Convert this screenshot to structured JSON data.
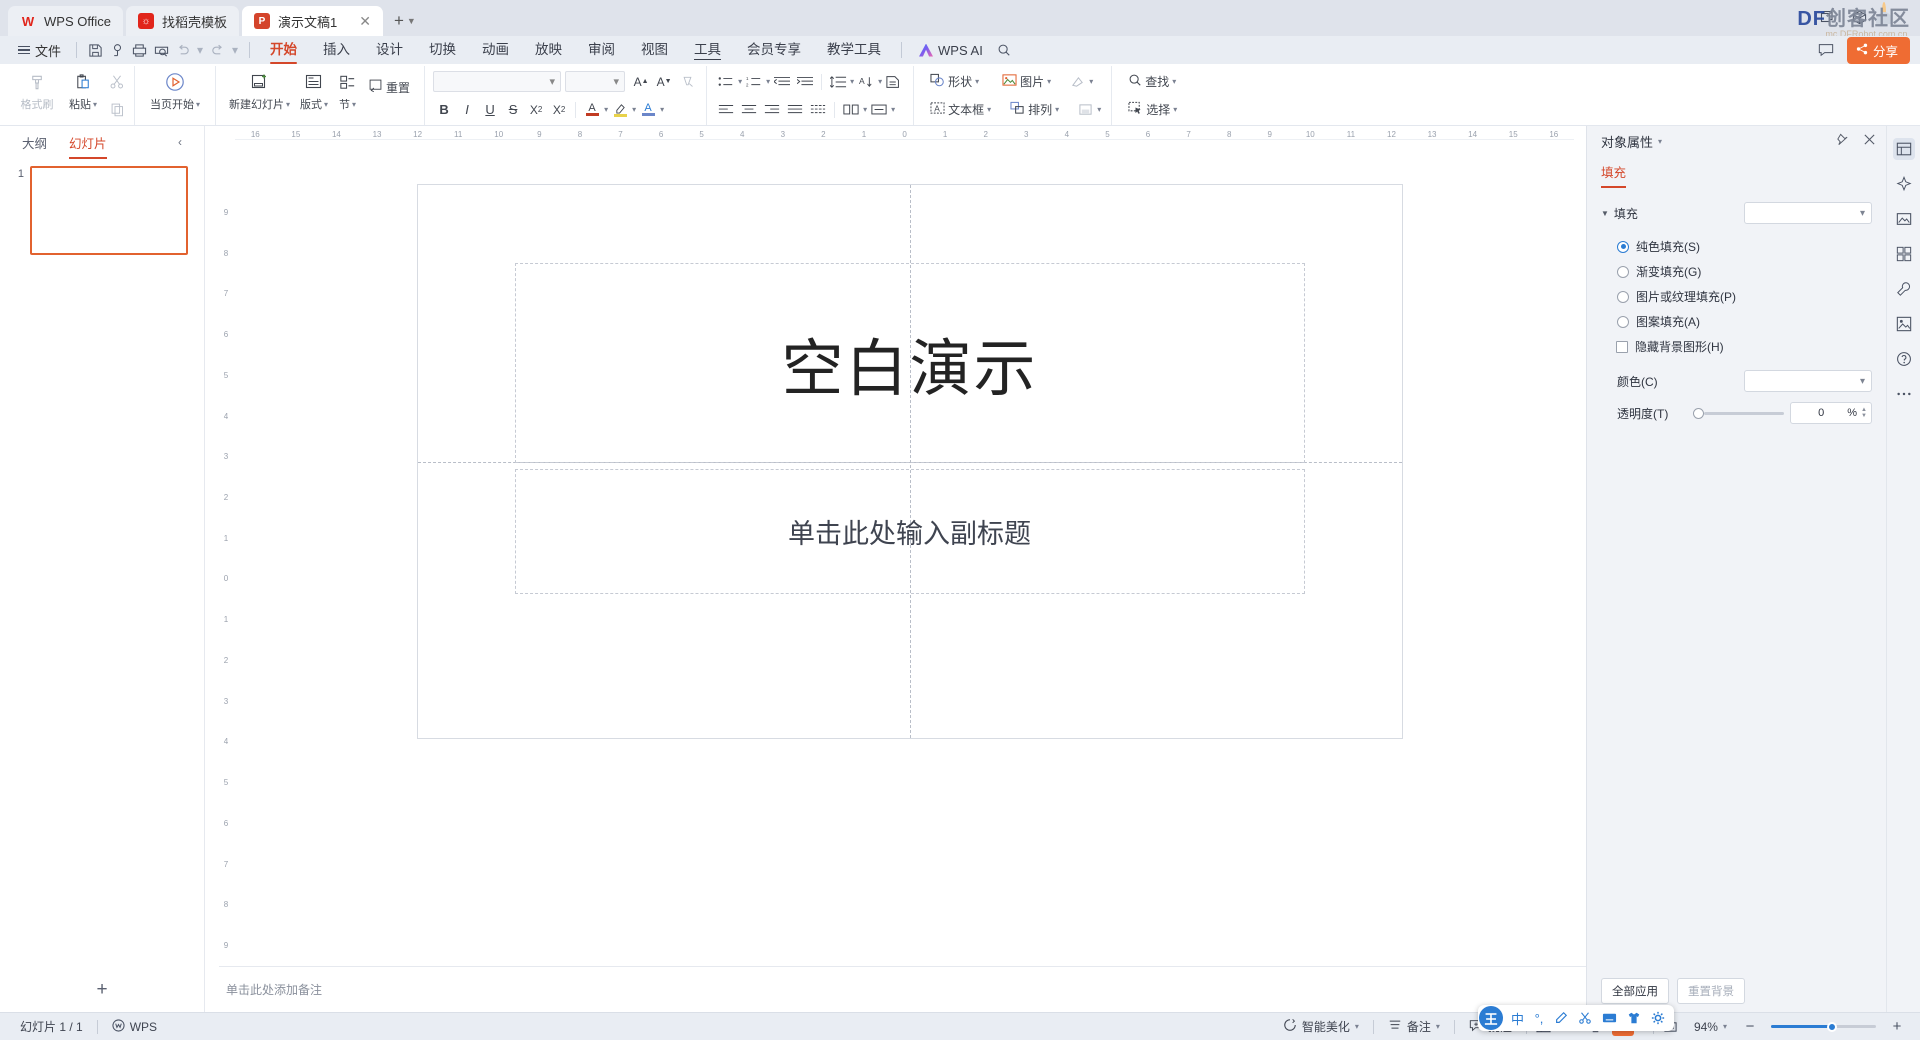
{
  "titlebar": {
    "tabs": [
      {
        "label": "WPS Office",
        "icon": "wps-logo-icon",
        "active": false,
        "closable": false
      },
      {
        "label": "找稻壳模板",
        "icon": "docer-icon",
        "active": false,
        "closable": false
      },
      {
        "label": "演示文稿1",
        "icon": "ppt-file-icon",
        "active": true,
        "closable": true
      }
    ],
    "new_tab_label": "+",
    "right_icons": [
      "window-restore-icon",
      "cube-3d-icon"
    ],
    "watermark_main": "DF",
    "watermark_cn": "创客社区",
    "watermark_sub": "mc.DFRobot.com.cn"
  },
  "menubar": {
    "file_label": "文件",
    "quick_icons": [
      "save-icon",
      "search-template-icon",
      "print-icon",
      "print-preview-icon",
      "undo-icon",
      "undo-dropdown-icon",
      "redo-icon",
      "customize-dropdown-icon"
    ],
    "tabs": [
      {
        "label": "开始",
        "active": true
      },
      {
        "label": "插入",
        "active": false
      },
      {
        "label": "设计",
        "active": false
      },
      {
        "label": "切换",
        "active": false
      },
      {
        "label": "动画",
        "active": false
      },
      {
        "label": "放映",
        "active": false
      },
      {
        "label": "审阅",
        "active": false
      },
      {
        "label": "视图",
        "active": false
      },
      {
        "label": "工具",
        "active": false,
        "underline": true
      },
      {
        "label": "会员专享",
        "active": false
      },
      {
        "label": "教学工具",
        "active": false
      }
    ],
    "ai_label": "WPS AI",
    "search_icon": "search-icon",
    "feedback_icon": "feedback-icon",
    "share_label": "分享"
  },
  "ribbon": {
    "group_clipboard": {
      "format_painter": "格式刷",
      "paste": "粘贴",
      "cut": "剪切",
      "copy": "复制"
    },
    "group_start": {
      "from_current": "当页开始"
    },
    "group_slides": {
      "new_slide": "新建幻灯片",
      "layout": "版式",
      "section": "节",
      "reset": "重置"
    },
    "font": {
      "name_value": "",
      "size_value": "",
      "grow_icon": "increase-font-size-icon",
      "shrink_icon": "decrease-font-size-icon",
      "clear_format_icon": "clear-formatting-icon",
      "bold": "B",
      "italic": "I",
      "underline": "U",
      "strike": "S",
      "superscript": "X²",
      "subscript": "X₂",
      "font_color_icon": "font-color-icon",
      "highlight_icon": "text-highlight-icon",
      "text_effect_icon": "text-effects-icon"
    },
    "paragraph": {
      "bullets_icon": "bullet-list-icon",
      "numbering_icon": "numbered-list-icon",
      "decrease_indent_icon": "decrease-indent-icon",
      "increase_indent_icon": "increase-indent-icon",
      "line_spacing_icon": "line-spacing-icon",
      "align_left_icon": "align-left-icon",
      "align_center_icon": "align-center-icon",
      "align_right_icon": "align-right-icon",
      "justify_icon": "justify-icon",
      "distribute_icon": "distribute-icon",
      "columns_icon": "columns-icon",
      "text_direction_icon": "text-direction-icon",
      "align_text_icon": "align-text-icon",
      "smartart_icon": "convert-to-smartart-icon"
    },
    "insert": {
      "shapes": "形状",
      "text_box": "文本框",
      "picture": "图片",
      "arrange": "排列",
      "quick_style_icon": "shape-quick-style-icon",
      "fill_icon": "shape-fill-icon"
    },
    "editing": {
      "find": "查找",
      "select": "选择"
    }
  },
  "leftpane": {
    "tab_outline": "大纲",
    "tab_slides": "幻灯片",
    "collapse_icon": "collapse-panel-icon",
    "slides": [
      {
        "number": "1"
      }
    ],
    "add_slide_icon": "add-slide-icon"
  },
  "editor": {
    "ruler_h_ticks": [
      "16",
      "15",
      "14",
      "13",
      "12",
      "11",
      "10",
      "9",
      "8",
      "7",
      "6",
      "5",
      "4",
      "3",
      "2",
      "1",
      "0",
      "1",
      "2",
      "3",
      "4",
      "5",
      "6",
      "7",
      "8",
      "9",
      "10",
      "11",
      "12",
      "13",
      "14",
      "15",
      "16"
    ],
    "ruler_v_ticks": [
      "9",
      "8",
      "7",
      "6",
      "5",
      "4",
      "3",
      "2",
      "1",
      "0",
      "1",
      "2",
      "3",
      "4",
      "5",
      "6",
      "7",
      "8",
      "9"
    ],
    "title_placeholder": "空白演示",
    "subtitle_placeholder": "单击此处输入副标题",
    "notes_placeholder": "单击此处添加备注"
  },
  "rightpane": {
    "title": "对象属性",
    "pin_icon": "pin-icon",
    "close_icon": "close-icon",
    "tabs": [
      {
        "label": "填充",
        "active": true
      }
    ],
    "fill_section_label": "填充",
    "fill_select_value": "",
    "options": [
      {
        "label": "纯色填充(S)",
        "type": "radio",
        "checked": true
      },
      {
        "label": "渐变填充(G)",
        "type": "radio",
        "checked": false
      },
      {
        "label": "图片或纹理填充(P)",
        "type": "radio",
        "checked": false
      },
      {
        "label": "图案填充(A)",
        "type": "radio",
        "checked": false
      },
      {
        "label": "隐藏背景图形(H)",
        "type": "checkbox",
        "checked": false
      }
    ],
    "color_label": "颜色(C)",
    "color_value": "",
    "transparency_label": "透明度(T)",
    "transparency_value": "0",
    "transparency_unit": "%",
    "apply_all_label": "全部应用",
    "reset_bg_label": "重置背景"
  },
  "rail": {
    "items": [
      "object-properties-icon",
      "ai-design-icon",
      "material-library-icon",
      "template-icon",
      "tools-icon",
      "image-resource-icon",
      "help-icon",
      "more-icon"
    ]
  },
  "statusbar": {
    "slide_counter": "幻灯片 1 / 1",
    "wps_label": "WPS",
    "beautify": "智能美化",
    "notes": "备注",
    "comments": "批注",
    "view_icons": [
      "normal-view-icon",
      "slide-sorter-icon",
      "reading-view-icon",
      "slideshow-icon"
    ],
    "fit_icon": "fit-to-window-icon",
    "zoom_value": "94%",
    "zoom_out": "−",
    "zoom_in": "+"
  },
  "ime": {
    "logo": "王",
    "items": [
      "中",
      "°,",
      "pen-icon",
      "scissors-icon",
      "keyboard-icon",
      "shirt-icon",
      "settings-icon"
    ]
  },
  "colors": {
    "accent": "#d4472a",
    "share": "#ef6c33",
    "selection": "#2b7cd3",
    "titlebar_bg": "#dfe3eb",
    "menubar_bg": "#e9edf3"
  }
}
